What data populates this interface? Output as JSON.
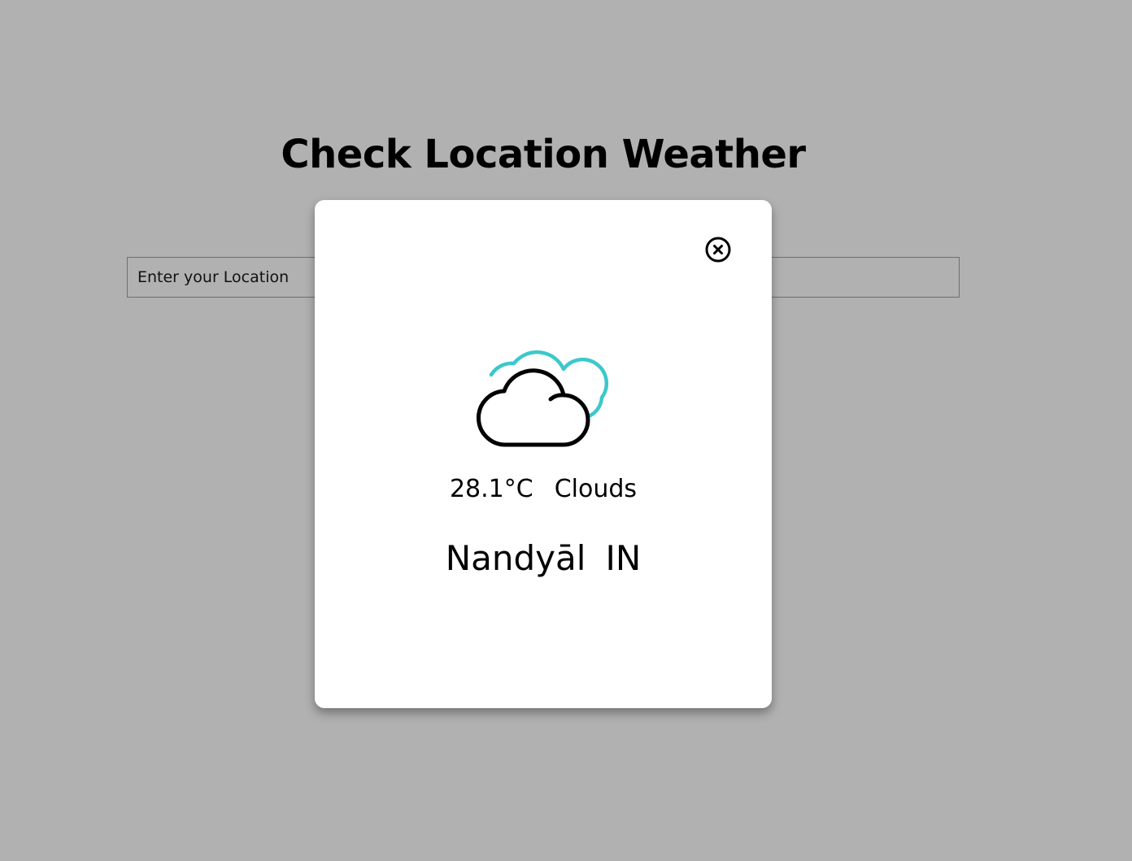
{
  "page": {
    "title": "Check Location Weather"
  },
  "search": {
    "placeholder": "Enter your Location",
    "value": ""
  },
  "modal": {
    "close_icon": "close-circle-icon",
    "weather_icon": "clouds-icon",
    "temperature": "28.1°C",
    "condition": "Clouds",
    "city": "Nandyāl",
    "country": "IN"
  },
  "colors": {
    "background": "#b1b1b1",
    "modal_background": "#ffffff",
    "cloud_accent": "#3cc8cc",
    "cloud_outline": "#000000"
  }
}
